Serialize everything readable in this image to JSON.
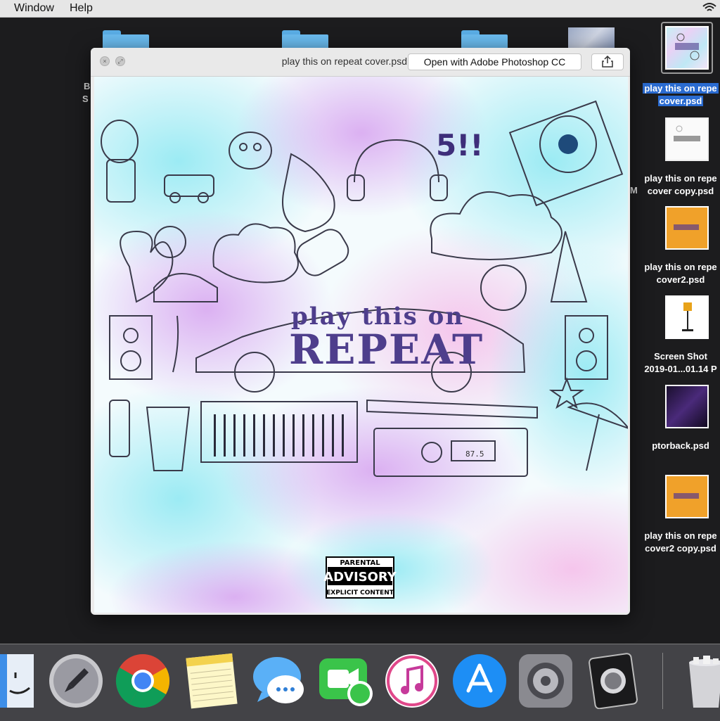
{
  "menubar": {
    "items": [
      "Window",
      "Help"
    ]
  },
  "desktop": {
    "partial_labels": [
      "B",
      "S",
      "M"
    ],
    "files": [
      {
        "name_line1": "play this on repe",
        "name_line2": "cover.psd",
        "selected": true
      },
      {
        "name_line1": "play this on repe",
        "name_line2": "cover copy.psd",
        "selected": false
      },
      {
        "name_line1": "play this on repe",
        "name_line2": "cover2.psd",
        "selected": false
      },
      {
        "name_line1": "Screen Shot",
        "name_line2": "2019-01...01.14 P",
        "selected": false
      },
      {
        "name_line1": "ptorback.psd",
        "name_line2": "",
        "selected": false
      },
      {
        "name_line1": "play this on repe",
        "name_line2": "cover2 copy.psd",
        "selected": false
      }
    ]
  },
  "quicklook": {
    "title": "play this on repeat cover.psd",
    "open_button": "Open with Adobe Photoshop CC",
    "cover": {
      "title_line1": "play this on",
      "title_line2": "REPEAT",
      "badge": "5!!",
      "radio_display": "87.5",
      "advisory_top": "PARENTAL",
      "advisory_mid": "ADVISORY",
      "advisory_bottom": "EXPLICIT CONTENT"
    }
  },
  "dock": {
    "apps": [
      "finder-icon",
      "launchpad-icon",
      "chrome-icon",
      "notes-icon",
      "messages-icon",
      "facetime-icon",
      "itunes-icon",
      "app-store-icon",
      "system-preferences-icon",
      "logic-pro-icon",
      "trash-icon"
    ]
  },
  "colors": {
    "selection": "#2a6bd1",
    "cover_text": "#4e3e8c",
    "folder_blue": "#6bbcf0"
  }
}
